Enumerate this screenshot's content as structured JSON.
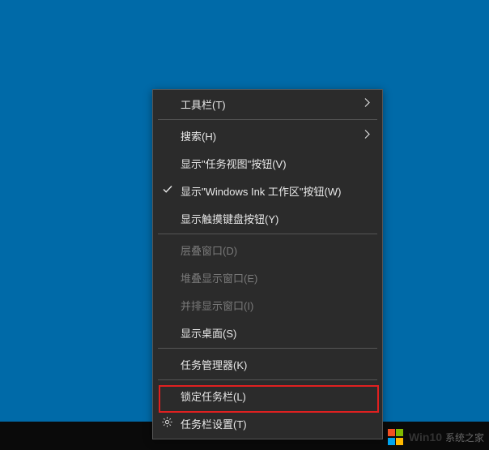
{
  "menu": {
    "toolbars": "工具栏(T)",
    "search": "搜索(H)",
    "show_taskview_button": "显示\"任务视图\"按钮(V)",
    "show_ink_workspace_button": "显示\"Windows Ink 工作区\"按钮(W)",
    "show_touchkeyboard_button": "显示触摸键盘按钮(Y)",
    "cascade_windows": "层叠窗口(D)",
    "stacked_windows": "堆叠显示窗口(E)",
    "side_by_side_windows": "并排显示窗口(I)",
    "show_desktop": "显示桌面(S)",
    "task_manager": "任务管理器(K)",
    "lock_taskbar": "锁定任务栏(L)",
    "taskbar_settings": "任务栏设置(T)"
  },
  "watermark": {
    "brand": "Win10",
    "sub": "系统之家"
  }
}
